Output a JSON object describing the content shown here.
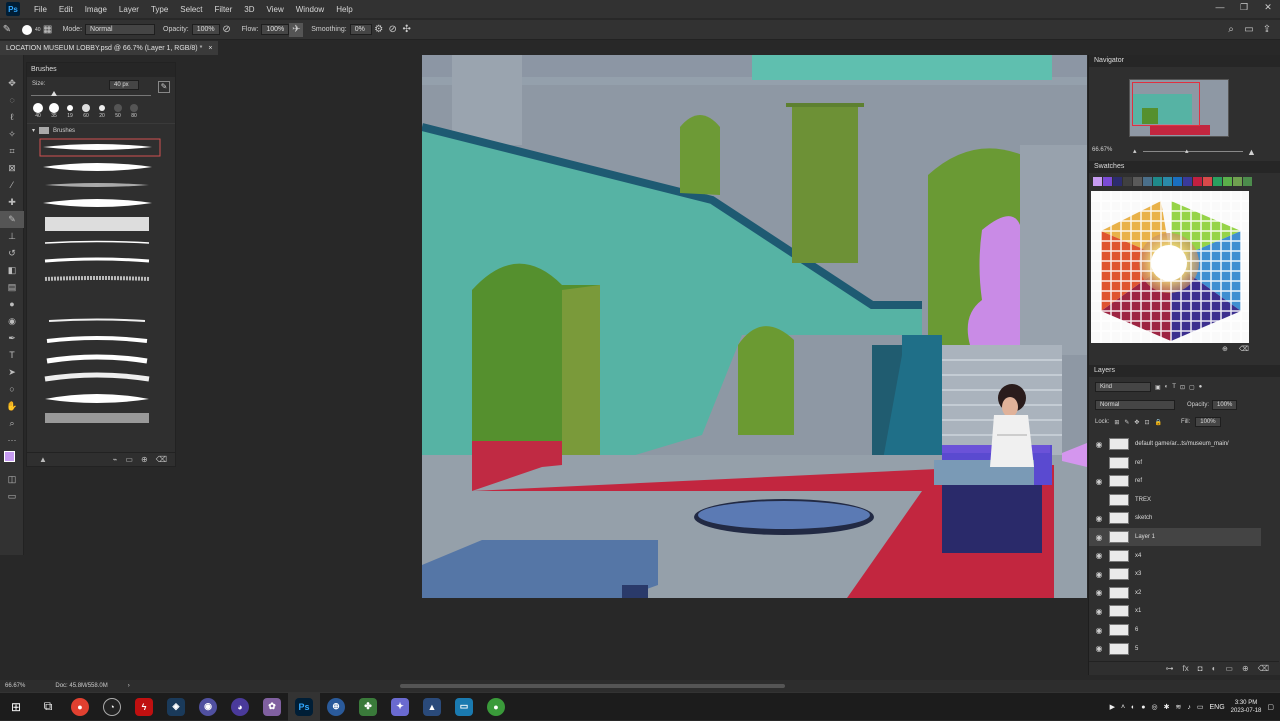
{
  "app": {
    "logo": "Ps",
    "accent": "#31a8ff"
  },
  "menu": [
    "File",
    "Edit",
    "Image",
    "Layer",
    "Type",
    "Select",
    "Filter",
    "3D",
    "View",
    "Window",
    "Help"
  ],
  "window_controls": [
    "—",
    "❐",
    "✕"
  ],
  "options": {
    "brush_size": "40",
    "mode_label": "Mode:",
    "mode_value": "Normal",
    "opacity_label": "Opacity:",
    "opacity_value": "100%",
    "flow_label": "Flow:",
    "flow_value": "100%",
    "smoothing_label": "Smoothing:",
    "smoothing_value": "0%"
  },
  "document_tab": {
    "title": "LOCATION MUSEUM LOBBY.psd @ 66.7% (Layer 1, RGB/8) *",
    "close": "×"
  },
  "brushes_panel": {
    "title": "Brushes",
    "size_label": "Size:",
    "size_value": "40 px",
    "presets": [
      "40",
      "35",
      "19",
      "60",
      "20",
      "50",
      "80"
    ],
    "group_name": "Brushes"
  },
  "navigator": {
    "title": "Navigator",
    "zoom": "66.67%"
  },
  "swatches": {
    "title": "Swatches",
    "colors": [
      "#c79cf2",
      "#7b4bd6",
      "#2c2c6e",
      "#404040",
      "#5a5a5a",
      "#4a6f8a",
      "#1f8a8a",
      "#2a8aa8",
      "#1a6fbf",
      "#3a3a9a",
      "#c12040",
      "#d84a4a",
      "#2aa060",
      "#5bb04a",
      "#70a050",
      "#4c8c4c"
    ]
  },
  "layers": {
    "title": "Layers",
    "filter": "Kind",
    "blend_mode": "Normal",
    "opacity_label": "Opacity:",
    "opacity_value": "100%",
    "lock_label": "Lock:",
    "fill_label": "Fill:",
    "fill_value": "100%",
    "items": [
      {
        "name": "default game/ar...ts/museum_main/",
        "visible": true,
        "selected": false
      },
      {
        "name": "ref",
        "visible": false,
        "selected": false
      },
      {
        "name": "ref",
        "visible": true,
        "selected": false
      },
      {
        "name": "TREX",
        "visible": false,
        "selected": false
      },
      {
        "name": "sketch",
        "visible": true,
        "selected": false
      },
      {
        "name": "Layer 1",
        "visible": true,
        "selected": true
      },
      {
        "name": "x4",
        "visible": true,
        "selected": false
      },
      {
        "name": "x3",
        "visible": true,
        "selected": false
      },
      {
        "name": "x2",
        "visible": true,
        "selected": false
      },
      {
        "name": "x1",
        "visible": true,
        "selected": false
      },
      {
        "name": "6",
        "visible": true,
        "selected": false
      },
      {
        "name": "5",
        "visible": true,
        "selected": false
      }
    ]
  },
  "status": {
    "zoom": "66.67%",
    "doc": "Doc: 45.8M/558.0M"
  },
  "taskbar": {
    "language": "ENG",
    "time": "3:30 PM",
    "date": "2023-07-18"
  }
}
